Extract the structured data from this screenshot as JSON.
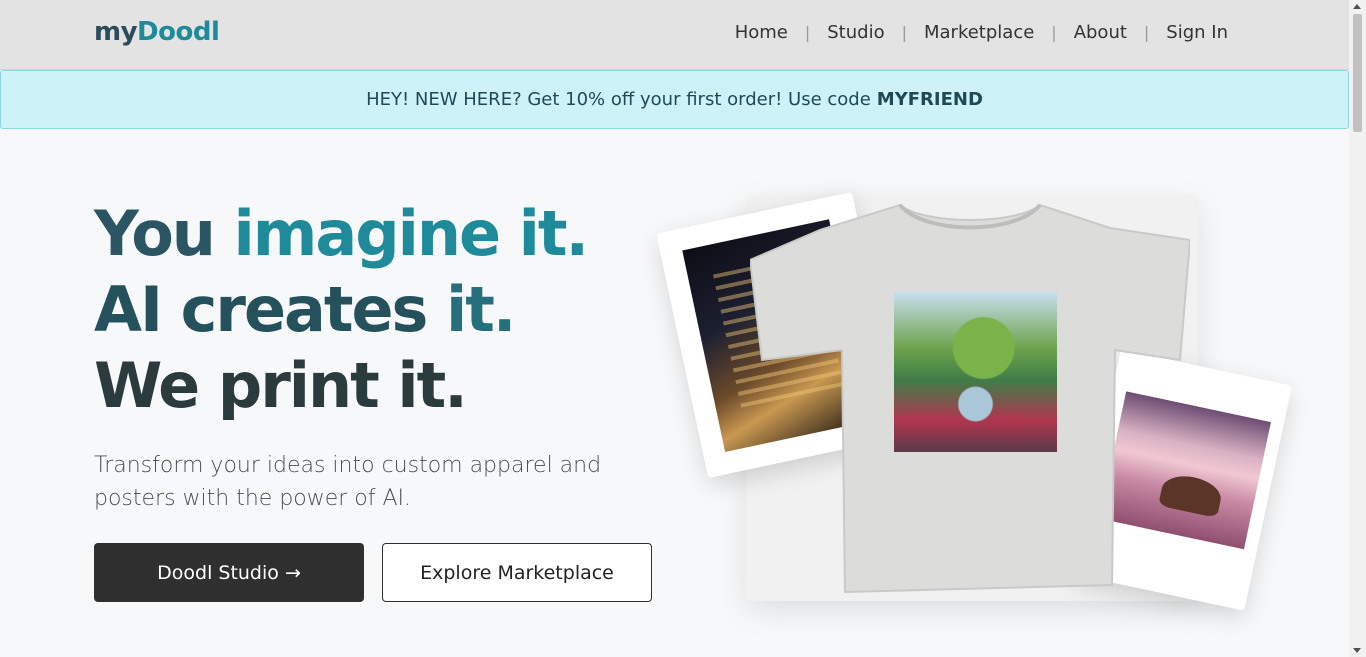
{
  "header": {
    "logo_my": "my",
    "logo_doodl": "Doodl",
    "nav": [
      "Home",
      "Studio",
      "Marketplace",
      "About",
      "Sign In"
    ],
    "separator": "|"
  },
  "banner": {
    "text": "HEY! NEW HERE? Get 10% off your first order! Use code",
    "code": "MYFRIEND"
  },
  "hero": {
    "line1_a": "You ",
    "line1_b": "imagine it.",
    "line2_a": "AI creates ",
    "line2_b": "it.",
    "line3": "We print it.",
    "subtitle": "Transform your ideas into custom apparel and posters with the power of AI.",
    "primary_button": "Doodl Studio →",
    "secondary_button": "Explore Marketplace"
  },
  "colors": {
    "brand_dark": "#2b4c5a",
    "brand_teal": "#1e8a9a",
    "banner_bg": "#cdf3f8",
    "button_dark": "#2f2f2f"
  }
}
